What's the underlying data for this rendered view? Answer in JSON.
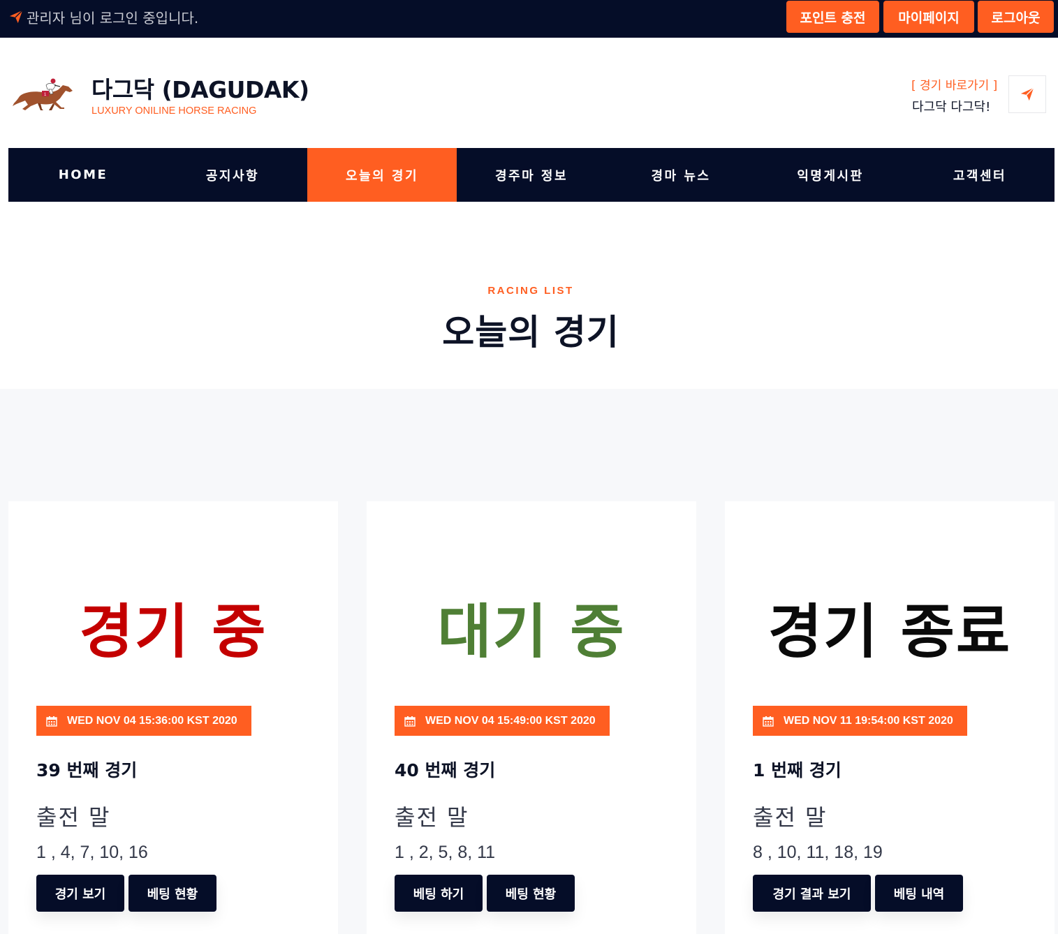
{
  "topbar": {
    "login_text": "관리자 님이 로그인 중입니다.",
    "buttons": {
      "charge": "포인트 충전",
      "mypage": "마이페이지",
      "logout": "로그아웃"
    }
  },
  "header": {
    "brand_title": "다그닥 (DAGUDAK)",
    "brand_subtitle": "LUXURY ONILINE HORSE RACING",
    "quick_link": "[ 경기 바로가기 ]",
    "quick_text": "다그닥 다그닥!"
  },
  "nav": {
    "items": [
      "HOME",
      "공지사항",
      "오늘의 경기",
      "경주마 정보",
      "경마 뉴스",
      "익명게시판",
      "고객센터"
    ],
    "active_index": 2
  },
  "section": {
    "kicker": "RACING LIST",
    "title": "오늘의 경기"
  },
  "races": [
    {
      "status": "경기 중",
      "status_color": "#c40000",
      "date": "WED NOV 04 15:36:00 KST 2020",
      "title": "39 번째 경기",
      "horse_label": "출전 말",
      "horses": "1 , 4, 7, 10, 16",
      "buttons": [
        "경기 보기",
        "베팅 현황"
      ]
    },
    {
      "status": "대기 중",
      "status_color": "#4f7f35",
      "date": "WED NOV 04 15:49:00 KST 2020",
      "title": "40 번째 경기",
      "horse_label": "출전 말",
      "horses": "1 , 2, 5, 8, 11",
      "buttons": [
        "베팅 하기",
        "베팅 현황"
      ]
    },
    {
      "status": "경기 종료",
      "status_color": "#0a0a0a",
      "date": "WED NOV 11 19:54:00 KST 2020",
      "title": "1 번째 경기",
      "horse_label": "출전 말",
      "horses": "8 , 10, 11, 18, 19",
      "buttons": [
        "경기 결과 보기",
        "베팅 내역"
      ]
    }
  ],
  "colors": {
    "accent": "#ff5e21",
    "navy": "#050d28",
    "gray_bg": "#f7f8fa"
  },
  "icons": {
    "login": "paper-plane-icon",
    "quick": "paper-plane-icon",
    "date": "calendar-icon",
    "logo": "horse-jockey-logo"
  }
}
